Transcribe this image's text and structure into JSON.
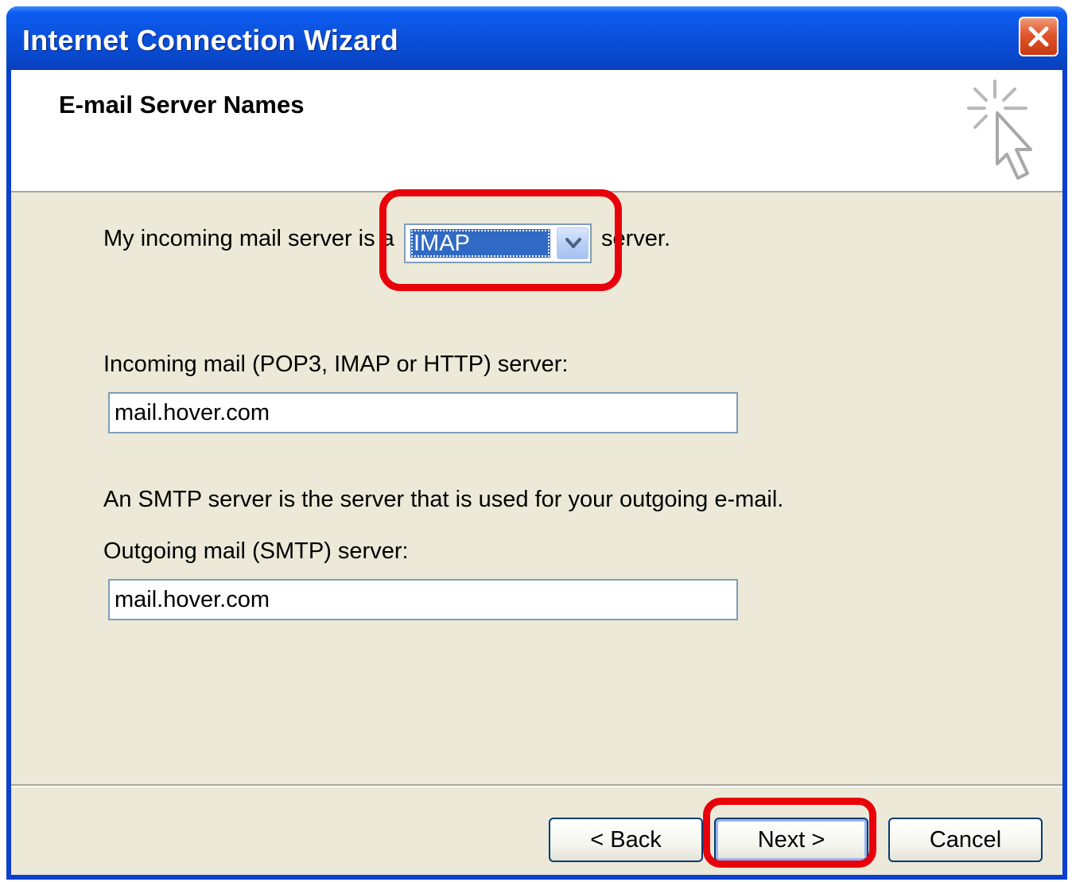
{
  "window": {
    "title": "Internet Connection Wizard"
  },
  "header": {
    "title": "E-mail Server Names"
  },
  "incoming_type": {
    "prefix": "My incoming mail server is a",
    "selected": "IMAP",
    "suffix": "server."
  },
  "incoming_server": {
    "label": "Incoming mail (POP3, IMAP or HTTP) server:",
    "value": "mail.hover.com"
  },
  "smtp_info": "An SMTP server is the server that is used for your outgoing e-mail.",
  "outgoing_server": {
    "label": "Outgoing mail (SMTP) server:",
    "value": "mail.hover.com"
  },
  "buttons": {
    "back": "< Back",
    "next": "Next >",
    "cancel": "Cancel"
  },
  "icons": {
    "close": "close-icon",
    "wizard": "wizard-cursor-icon",
    "dropdown": "chevron-down-icon"
  },
  "colors": {
    "titlebar": "#0a4fd8",
    "dialog_bg": "#ece9d8",
    "selection": "#316ac5",
    "highlight_ring": "#e8000b",
    "close_button": "#e0552c"
  }
}
